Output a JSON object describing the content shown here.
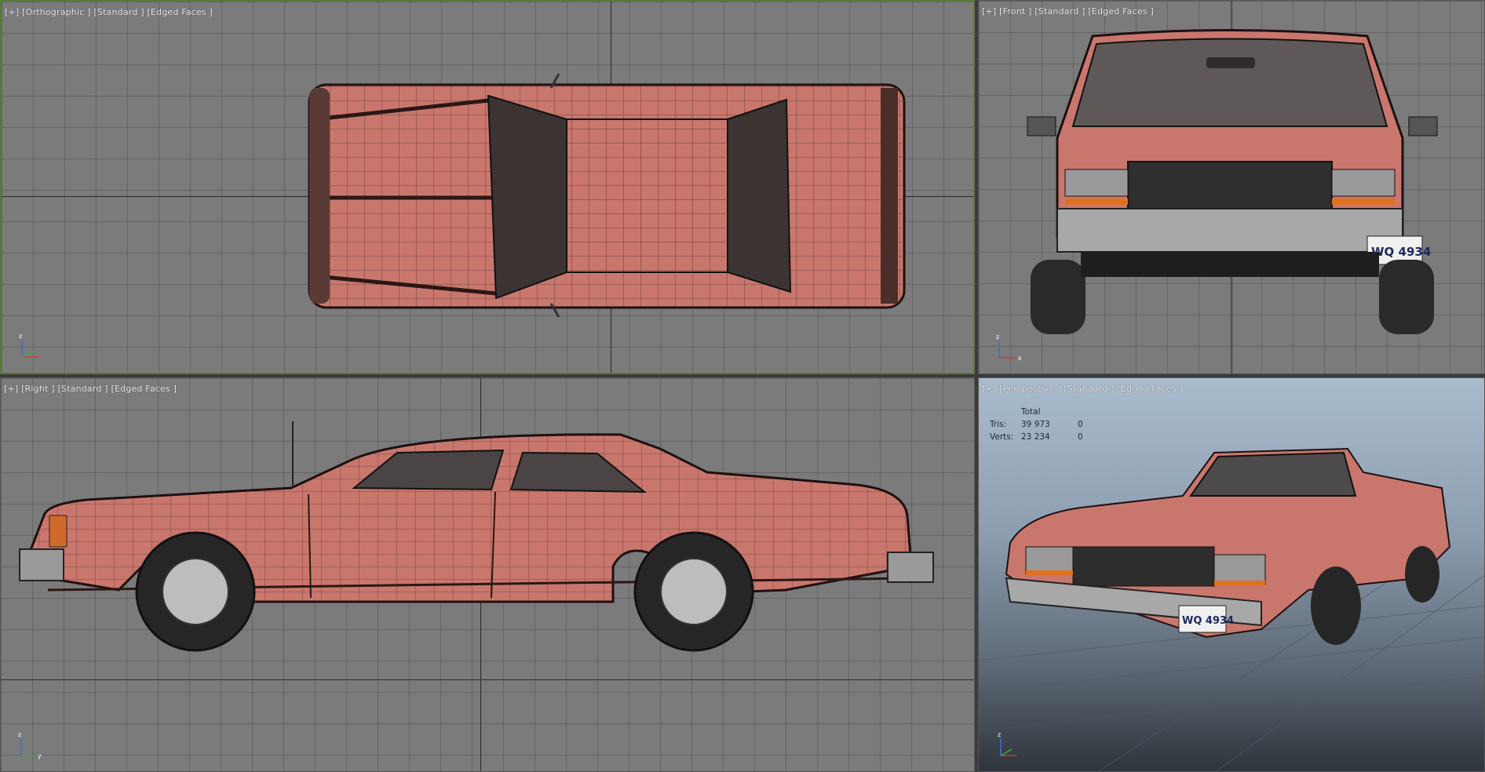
{
  "viewports": {
    "top": {
      "label": "[+] [Orthographic ] [Standard ] [Edged Faces ]"
    },
    "front": {
      "label": "[+] [Front ] [Standard ] [Edged Faces ]"
    },
    "right": {
      "label": "[+] [Right ] [Standard ] [Edged Faces ]"
    },
    "persp": {
      "label": "[+] [Perspective ] [Standard ] [Edged Faces ]"
    }
  },
  "stats": {
    "header": "Total",
    "rows": [
      {
        "label": "Tris:",
        "total": "39 973",
        "selected": "0"
      },
      {
        "label": "Verts:",
        "total": "23 234",
        "selected": "0"
      }
    ]
  },
  "license_plate": "WQ 4934",
  "axes": {
    "x": "x",
    "y": "y",
    "z": "z"
  },
  "colors": {
    "body": "#c9776d",
    "body_dark": "#a45a52",
    "wire": "#2a1714",
    "tire": "#2a2a2a",
    "grid_bg": "#7b7b7b",
    "active_border": "#5a7a3a"
  },
  "model_name_icon": "car-wireframe"
}
